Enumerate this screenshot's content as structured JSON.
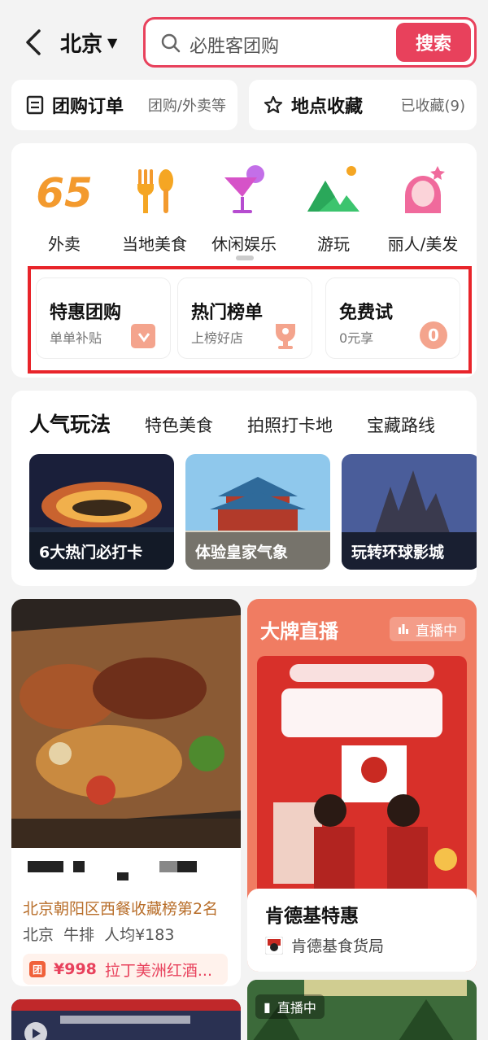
{
  "header": {
    "city": "北京",
    "search_placeholder": "必胜客团购",
    "search_button": "搜索"
  },
  "quick": [
    {
      "title": "团购订单",
      "sub": "团购/外卖等",
      "icon": "order-icon"
    },
    {
      "title": "地点收藏",
      "sub": "已收藏(9)",
      "icon": "star-icon"
    }
  ],
  "categories": [
    {
      "label": "外卖",
      "icon": "delivery-65-icon"
    },
    {
      "label": "当地美食",
      "icon": "fork-spoon-icon"
    },
    {
      "label": "休闲娱乐",
      "icon": "cocktail-icon"
    },
    {
      "label": "游玩",
      "icon": "mountain-icon"
    },
    {
      "label": "丽人/美发",
      "icon": "beauty-icon"
    }
  ],
  "promos": [
    {
      "title": "特惠团购",
      "sub": "单单补贴",
      "icon": "coupon-icon"
    },
    {
      "title": "热门榜单",
      "sub": "上榜好店",
      "icon": "trophy-icon"
    },
    {
      "title": "免费试",
      "sub": "0元享",
      "icon": "zero-yuan-icon"
    }
  ],
  "popular": {
    "tabs": [
      "人气玩法",
      "特色美食",
      "拍照打卡地",
      "宝藏路线"
    ],
    "tiles": [
      "6大热门必打卡",
      "体验皇家气象",
      "玩转环球影城"
    ]
  },
  "feed_left": {
    "rank": "北京朝阳区西餐收藏榜第2名",
    "meta": "北京 牛排 人均¥183",
    "deal_badge": "团",
    "price": "¥998",
    "deal_name": "拉丁美洲红酒..."
  },
  "feed_right": {
    "title": "大牌直播",
    "live": "直播中",
    "name": "肯德基特惠",
    "shop": "肯德基食货局"
  },
  "bottom_right": {
    "live": "直播中"
  },
  "colors": {
    "accent": "#e8415c",
    "highlight_box": "#e8242a"
  }
}
